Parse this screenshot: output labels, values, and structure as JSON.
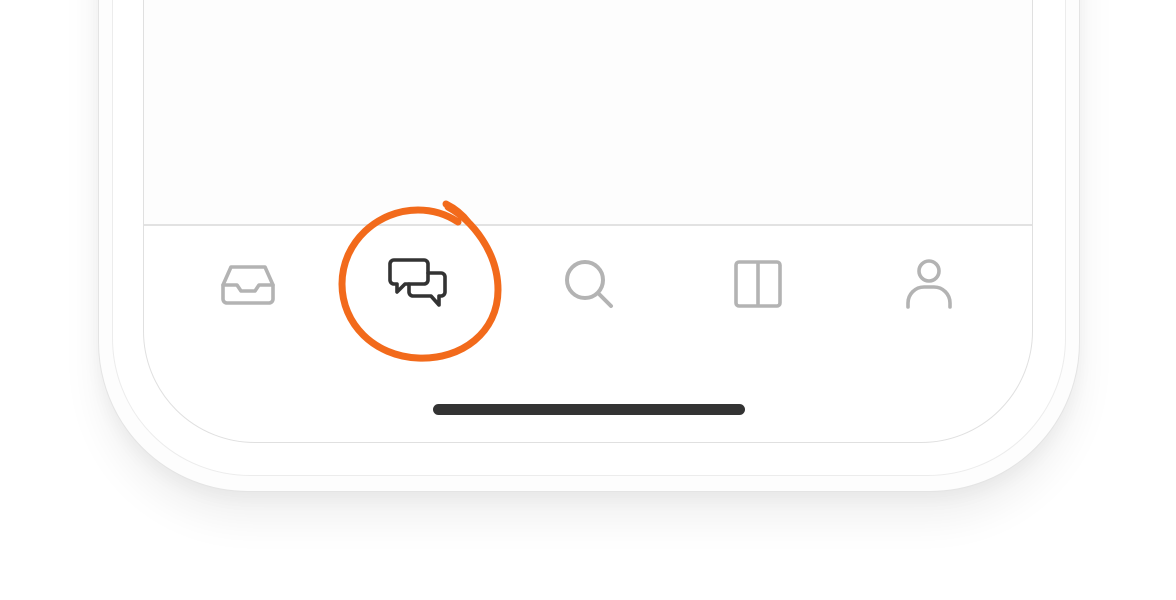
{
  "tab_bar": {
    "tabs": [
      {
        "icon": "inbox-icon",
        "active": false
      },
      {
        "icon": "chat-bubbles-icon",
        "active": true
      },
      {
        "icon": "search-icon",
        "active": false
      },
      {
        "icon": "columns-icon",
        "active": false
      },
      {
        "icon": "profile-icon",
        "active": false
      }
    ]
  },
  "colors": {
    "active_icon": "#333333",
    "inactive_icon": "#b3b3b3",
    "annotation": "#f26a1b",
    "home_indicator": "#333333"
  },
  "annotation": {
    "shape": "hand-drawn-circle",
    "target": "chat-bubbles-icon"
  }
}
